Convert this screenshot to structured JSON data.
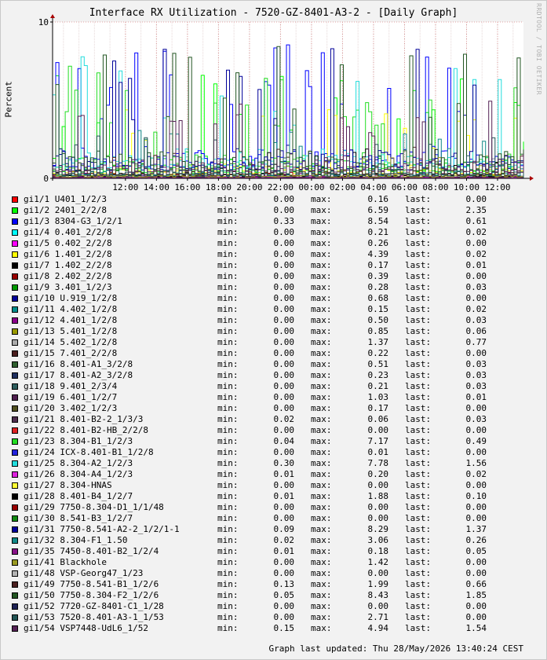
{
  "title": "Interface RX Utilization - 7520-GZ-8401-A3-2 - [Daily Graph]",
  "watermark": "RRDTOOL / TOBI OETIKER",
  "footer": "Graph last updated: Thu 28/May/2026 13:40:24 CEST",
  "legend_labels": {
    "min": "min:",
    "max": "max:",
    "last": "last:"
  },
  "chart_data": {
    "type": "line",
    "ylabel": "Percent",
    "ylim": [
      0,
      10
    ],
    "y_ticks": [
      {
        "value": 0,
        "label": "0"
      },
      {
        "value": 10,
        "label": "10"
      }
    ],
    "x_range_hours": [
      7.3,
      13.67
    ],
    "x_ticks": [
      {
        "hour": 12,
        "label": "12:00"
      },
      {
        "hour": 14,
        "label": "14:00"
      },
      {
        "hour": 16,
        "label": "16:00"
      },
      {
        "hour": 18,
        "label": "18:00"
      },
      {
        "hour": 20,
        "label": "20:00"
      },
      {
        "hour": 22,
        "label": "22:00"
      },
      {
        "hour": 24,
        "label": "00:00"
      },
      {
        "hour": 26,
        "label": "02:00"
      },
      {
        "hour": 28,
        "label": "04:00"
      },
      {
        "hour": 30,
        "label": "06:00"
      },
      {
        "hour": 32,
        "label": "08:00"
      },
      {
        "hour": 34,
        "label": "10:00"
      },
      {
        "hour": 36,
        "label": "12:00"
      }
    ],
    "grid": true,
    "legend_position": "bottom",
    "series": [
      {
        "name": "gi1/1 U401_1/2/3",
        "color": "#ff0000",
        "min": "0.00",
        "max": "0.16",
        "last": "0.00"
      },
      {
        "name": "gi1/2 2401_2/2/8",
        "color": "#00ff00",
        "min": "0.00",
        "max": "6.59",
        "last": "2.35"
      },
      {
        "name": "gi1/3 8304-G3_1/2/1",
        "color": "#0000ff",
        "min": "0.33",
        "max": "8.54",
        "last": "0.61"
      },
      {
        "name": "gi1/4 0.401_2/2/8",
        "color": "#00ffff",
        "min": "0.00",
        "max": "0.21",
        "last": "0.02"
      },
      {
        "name": "gi1/5 0.402_2/2/8",
        "color": "#ff00ff",
        "min": "0.00",
        "max": "0.26",
        "last": "0.00"
      },
      {
        "name": "gi1/6 1.401_2/2/8",
        "color": "#ffff00",
        "min": "0.00",
        "max": "4.39",
        "last": "0.02"
      },
      {
        "name": "gi1/7 1.402_2/2/8",
        "color": "#000000",
        "min": "0.00",
        "max": "0.17",
        "last": "0.01"
      },
      {
        "name": "gi1/8 2.402_2/2/8",
        "color": "#990000",
        "min": "0.00",
        "max": "0.39",
        "last": "0.00"
      },
      {
        "name": "gi1/9 3.401_1/2/3",
        "color": "#009900",
        "min": "0.00",
        "max": "0.28",
        "last": "0.03"
      },
      {
        "name": "gi1/10 U.919_1/2/8",
        "color": "#000099",
        "min": "0.00",
        "max": "0.68",
        "last": "0.00"
      },
      {
        "name": "gi1/11 4.402_1/2/8",
        "color": "#008b8b",
        "min": "0.00",
        "max": "0.15",
        "last": "0.02"
      },
      {
        "name": "gi1/12 4.401_1/2/8",
        "color": "#8b008b",
        "min": "0.00",
        "max": "0.50",
        "last": "0.03"
      },
      {
        "name": "gi1/13 5.401_1/2/8",
        "color": "#999900",
        "min": "0.00",
        "max": "0.85",
        "last": "0.06"
      },
      {
        "name": "gi1/14 5.402_1/2/8",
        "color": "#aaaaaa",
        "min": "0.00",
        "max": "1.37",
        "last": "0.77"
      },
      {
        "name": "gi1/15 7.401_2/2/8",
        "color": "#4b1e1e",
        "min": "0.00",
        "max": "0.22",
        "last": "0.00"
      },
      {
        "name": "gi1/16 8.401-A1_3/2/8",
        "color": "#2e5e2e",
        "min": "0.00",
        "max": "0.51",
        "last": "0.03"
      },
      {
        "name": "gi1/17 8.401-A2_3/2/8",
        "color": "#1e2e5e",
        "min": "0.00",
        "max": "0.23",
        "last": "0.03"
      },
      {
        "name": "gi1/18 9.401_2/3/4",
        "color": "#2e5e5e",
        "min": "0.00",
        "max": "0.21",
        "last": "0.03"
      },
      {
        "name": "gi1/19 6.401_1/2/7",
        "color": "#4e1e4e",
        "min": "0.00",
        "max": "1.03",
        "last": "0.01"
      },
      {
        "name": "gi1/20 3.402_1/2/3",
        "color": "#4e4e1e",
        "min": "0.00",
        "max": "0.17",
        "last": "0.00"
      },
      {
        "name": "gi1/21 8.401-B2-2_1/3/3",
        "color": "#4e2e4e",
        "min": "0.02",
        "max": "0.06",
        "last": "0.03"
      },
      {
        "name": "gi1/22 8.401-B2-HB_2/2/8",
        "color": "#dd2222",
        "min": "0.00",
        "max": "0.00",
        "last": "0.00"
      },
      {
        "name": "gi1/23 8.304-B1_1/2/3",
        "color": "#22dd22",
        "min": "0.04",
        "max": "7.17",
        "last": "0.49"
      },
      {
        "name": "gi1/24 ICX-8.401-B1_1/2/8",
        "color": "#2222dd",
        "min": "0.00",
        "max": "0.01",
        "last": "0.00"
      },
      {
        "name": "gi1/25 8.304-A2_1/2/3",
        "color": "#22dddd",
        "min": "0.30",
        "max": "7.78",
        "last": "1.56"
      },
      {
        "name": "gi1/26 8.304-A4_1/2/3",
        "color": "#dd22dd",
        "min": "0.01",
        "max": "0.20",
        "last": "0.02"
      },
      {
        "name": "gi1/27 8.304-HNAS",
        "color": "#ffff33",
        "min": "0.00",
        "max": "0.00",
        "last": "0.00"
      },
      {
        "name": "gi1/28 8.401-B4_1/2/7",
        "color": "#000000",
        "min": "0.01",
        "max": "1.88",
        "last": "0.10"
      },
      {
        "name": "gi1/29 7750-8.304-D1_1/1/48",
        "color": "#990000",
        "min": "0.00",
        "max": "0.00",
        "last": "0.00"
      },
      {
        "name": "gi1/30 8.541-B3_1/2/7",
        "color": "#118811",
        "min": "0.00",
        "max": "0.00",
        "last": "0.00"
      },
      {
        "name": "gi1/31 7750-8.541-A2-2_1/2/1-1",
        "color": "#000099",
        "min": "0.09",
        "max": "8.29",
        "last": "1.37"
      },
      {
        "name": "gi1/32 8.304-F1_1.50",
        "color": "#118888",
        "min": "0.02",
        "max": "3.06",
        "last": "0.26"
      },
      {
        "name": "gi1/35 7450-8.401-B2_1/2/4",
        "color": "#881188",
        "min": "0.01",
        "max": "0.18",
        "last": "0.05"
      },
      {
        "name": "gi1/41 Blackhole",
        "color": "#999922",
        "min": "0.00",
        "max": "1.42",
        "last": "0.00"
      },
      {
        "name": "gi1/48 VSP-Georg47_1/23",
        "color": "#b3b3b3",
        "min": "0.00",
        "max": "0.00",
        "last": "0.00"
      },
      {
        "name": "gi1/49 7750-8.541-B1_1/2/6",
        "color": "#4b2020",
        "min": "0.13",
        "max": "1.99",
        "last": "0.66"
      },
      {
        "name": "gi1/50 7750-8.304-F2_1/2/6",
        "color": "#225522",
        "min": "0.05",
        "max": "8.43",
        "last": "1.85"
      },
      {
        "name": "gi1/52 7720-GZ-8401-C1_1/28",
        "color": "#1e2255",
        "min": "0.00",
        "max": "0.00",
        "last": "0.00"
      },
      {
        "name": "gi1/53 7520-8.401-A3-1_1/53",
        "color": "#225555",
        "min": "0.00",
        "max": "2.71",
        "last": "0.00"
      },
      {
        "name": "gi1/54 VSP7448-UdL6_1/52",
        "color": "#552255",
        "min": "0.15",
        "max": "4.94",
        "last": "1.54"
      }
    ]
  }
}
